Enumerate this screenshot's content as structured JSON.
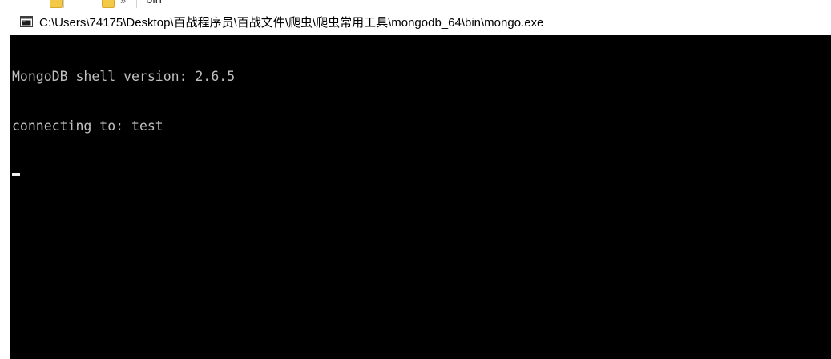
{
  "background_window": {
    "crumb_text": "bin",
    "crumb_separator": "»"
  },
  "console": {
    "title": "C:\\Users\\74175\\Desktop\\百战程序员\\百战文件\\爬虫\\爬虫常用工具\\mongodb_64\\bin\\mongo.exe",
    "icon": "console-app-icon",
    "lines": [
      "MongoDB shell version: 2.6.5",
      "connecting to: test"
    ],
    "colors": {
      "background": "#000000",
      "text": "#c0c0c0",
      "cursor": "#f0f0f0",
      "titlebar": "#ffffff"
    }
  }
}
